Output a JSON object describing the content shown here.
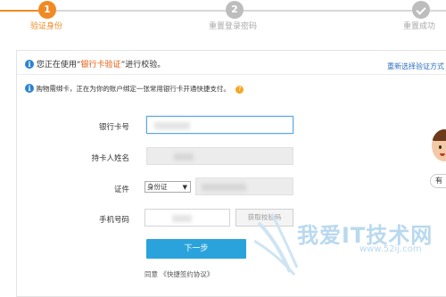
{
  "steps": [
    {
      "number": "1",
      "label": "验证身份"
    },
    {
      "number": "2",
      "label": "重置登录密码"
    },
    {
      "number": "",
      "label": "重置成功"
    }
  ],
  "verify": {
    "prefix": "您正在使用“",
    "method": "银行卡验证",
    "suffix": "”进行校验。",
    "switch_link": "重新选择验证方式"
  },
  "notice": {
    "text": "购物需绑卡，正在为你的账户绑定一张常用银行卡开通快捷支付。"
  },
  "form": {
    "card_label": "银行卡号",
    "holder_label": "持卡人姓名",
    "id_label": "证件",
    "id_type": "身份证",
    "phone_label": "手机号码",
    "sms_button": "获取校验码",
    "next_button": "下一步",
    "agree_prefix": "同意",
    "agree_link": "《快捷签约协议》"
  },
  "side": {
    "button_label": "有"
  },
  "watermark": {
    "text": "我爱IT技术网",
    "url": "www.52ij.com"
  },
  "colors": {
    "accent_orange": "#f08a24",
    "primary_blue": "#2aa3dc",
    "link_blue": "#2d6fc2",
    "inactive_gray": "#bdbdbd"
  }
}
